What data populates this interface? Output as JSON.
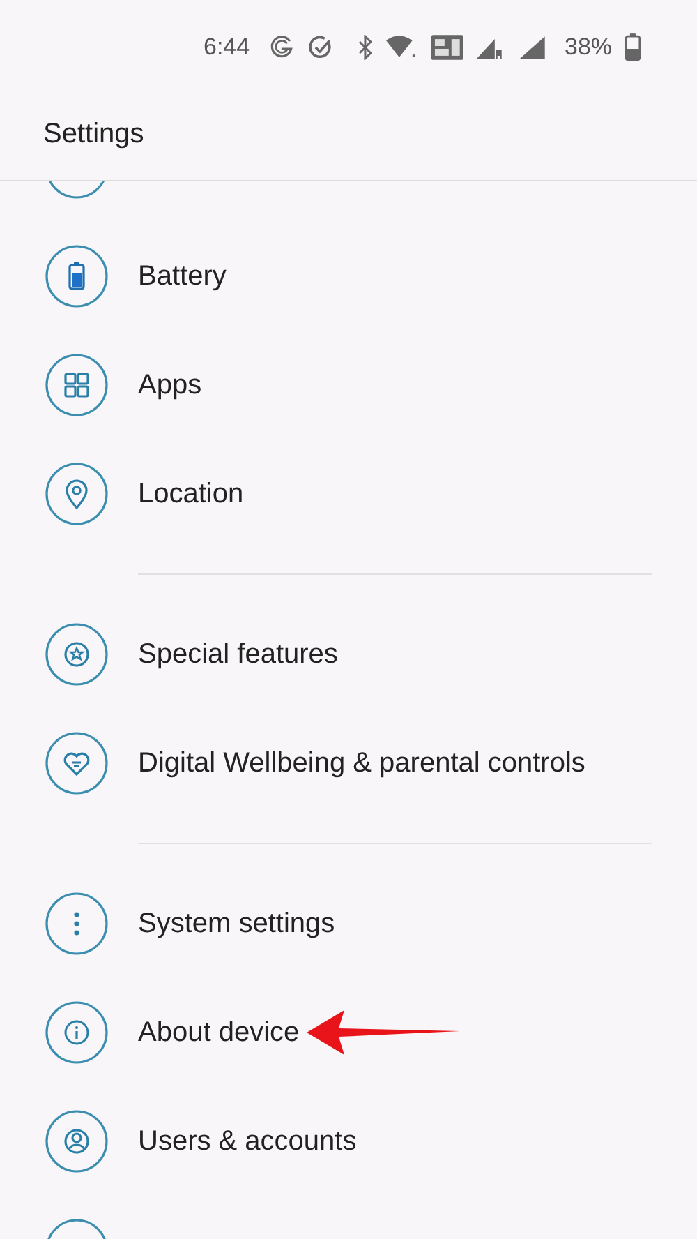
{
  "status_bar": {
    "time": "6:44",
    "battery_percent": "38%"
  },
  "title": "Settings",
  "groups": [
    {
      "items": [
        {
          "label": "Battery",
          "highlighted": false
        },
        {
          "label": "Apps",
          "highlighted": false
        },
        {
          "label": "Location",
          "highlighted": false
        }
      ]
    },
    {
      "items": [
        {
          "label": "Special features",
          "highlighted": false
        },
        {
          "label": "Digital Wellbeing & parental controls",
          "highlighted": false
        }
      ]
    },
    {
      "items": [
        {
          "label": "System settings",
          "highlighted": false
        },
        {
          "label": "About device",
          "highlighted": true
        },
        {
          "label": "Users & accounts",
          "highlighted": false
        }
      ]
    }
  ]
}
